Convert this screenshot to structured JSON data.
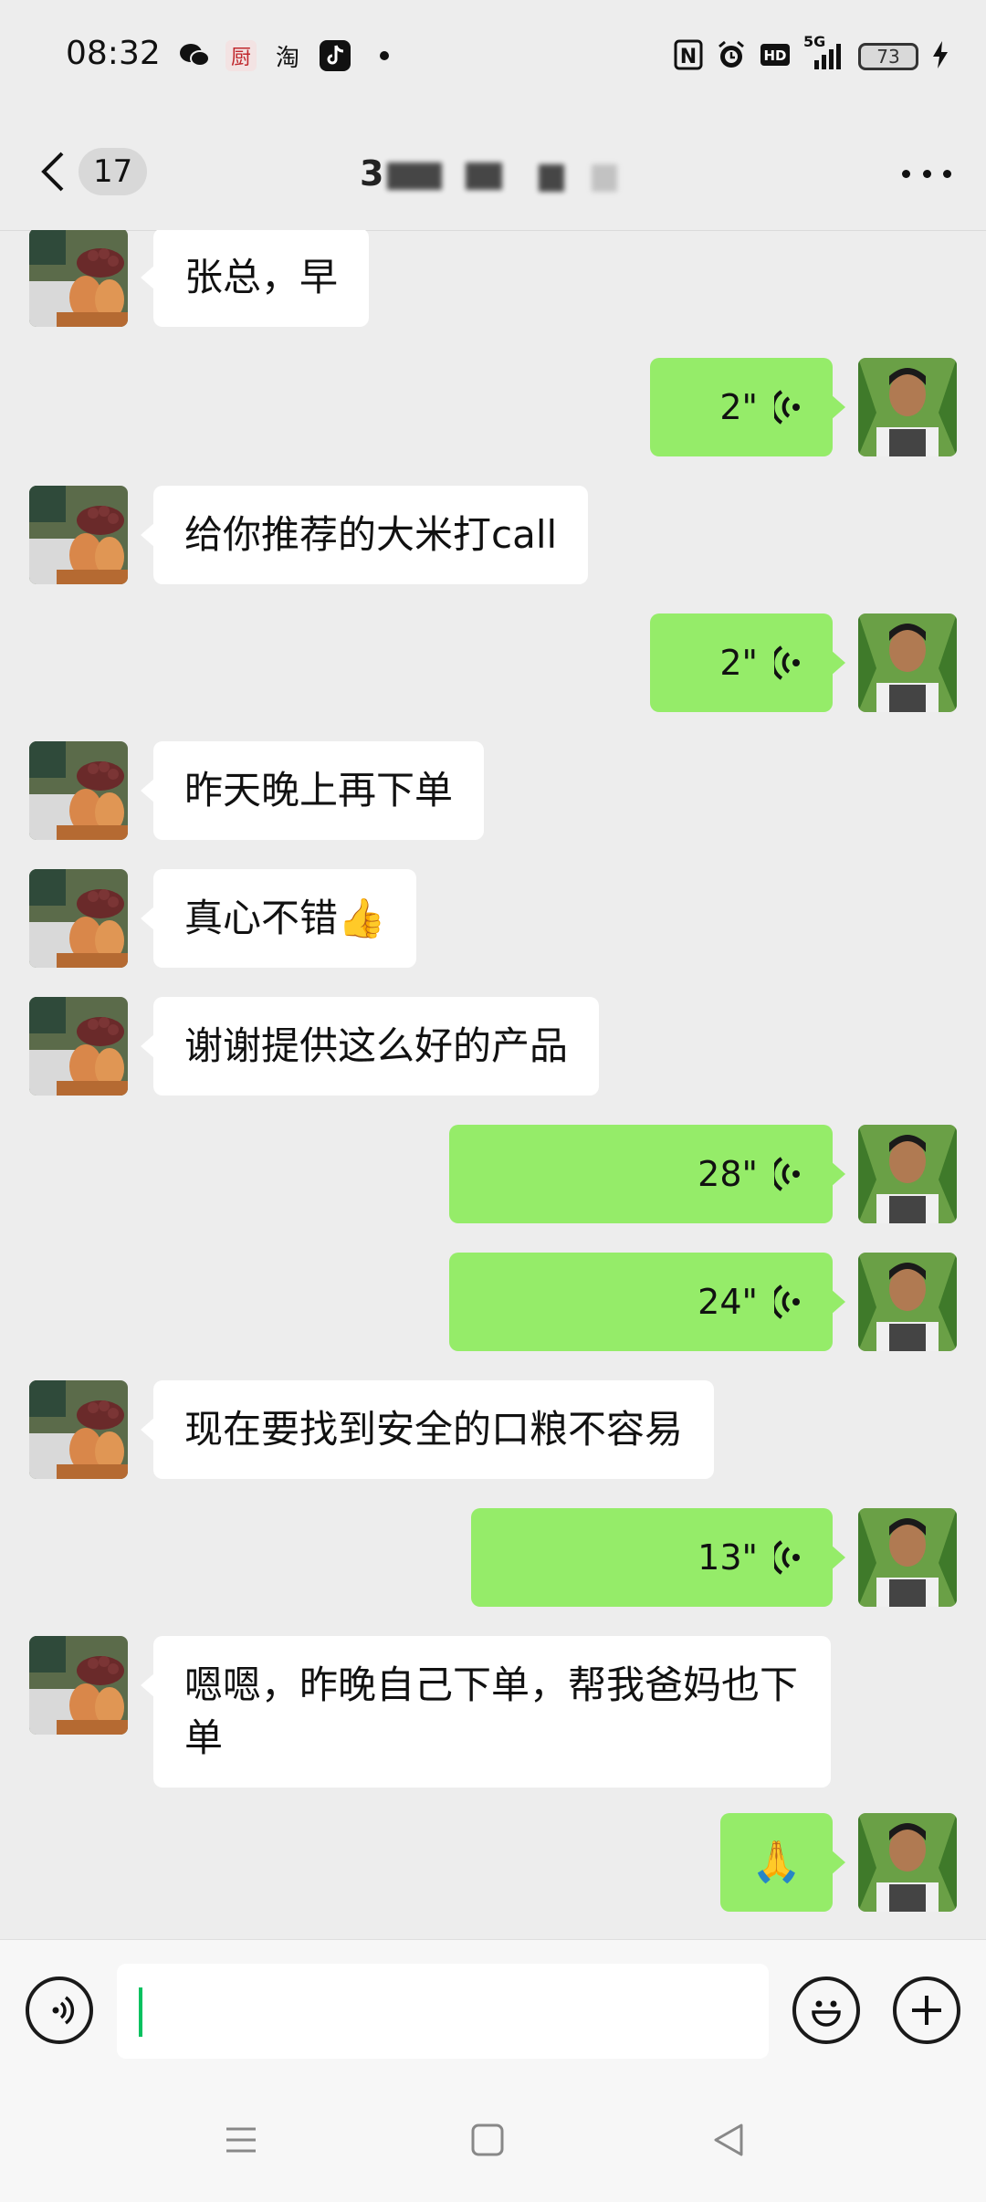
{
  "status_bar": {
    "time": "08:32",
    "apps": [
      "wechat-icon",
      "chef-app-icon",
      "taobao-icon",
      "tiktok-icon"
    ],
    "chef_label": "厨",
    "taobao_label": "淘",
    "network": "5G",
    "battery": "73"
  },
  "nav": {
    "unread_count": "17",
    "title_visible": "3"
  },
  "messages": [
    {
      "side": "left",
      "type": "text",
      "text": "张总，早"
    },
    {
      "side": "right",
      "type": "voice",
      "duration": "2\""
    },
    {
      "side": "left",
      "type": "text",
      "text": "给你推荐的大米打call"
    },
    {
      "side": "right",
      "type": "voice",
      "duration": "2\""
    },
    {
      "side": "left",
      "type": "text",
      "text": "昨天晚上再下单"
    },
    {
      "side": "left",
      "type": "text",
      "text": "真心不错👍"
    },
    {
      "side": "left",
      "type": "text",
      "text": "谢谢提供这么好的产品"
    },
    {
      "side": "right",
      "type": "voice",
      "duration": "28\""
    },
    {
      "side": "right",
      "type": "voice",
      "duration": "24\""
    },
    {
      "side": "left",
      "type": "text",
      "text": "现在要找到安全的口粮不容易"
    },
    {
      "side": "right",
      "type": "voice",
      "duration": "13\""
    },
    {
      "side": "left",
      "type": "text",
      "text": "嗯嗯，昨晚自己下单，帮我爸妈也下单"
    },
    {
      "side": "right",
      "type": "emoji",
      "text": "🙏"
    }
  ],
  "input": {
    "value": ""
  },
  "colors": {
    "background": "#ededed",
    "outgoing_bubble": "#95ec69",
    "incoming_bubble": "#ffffff",
    "caret": "#07c160"
  }
}
